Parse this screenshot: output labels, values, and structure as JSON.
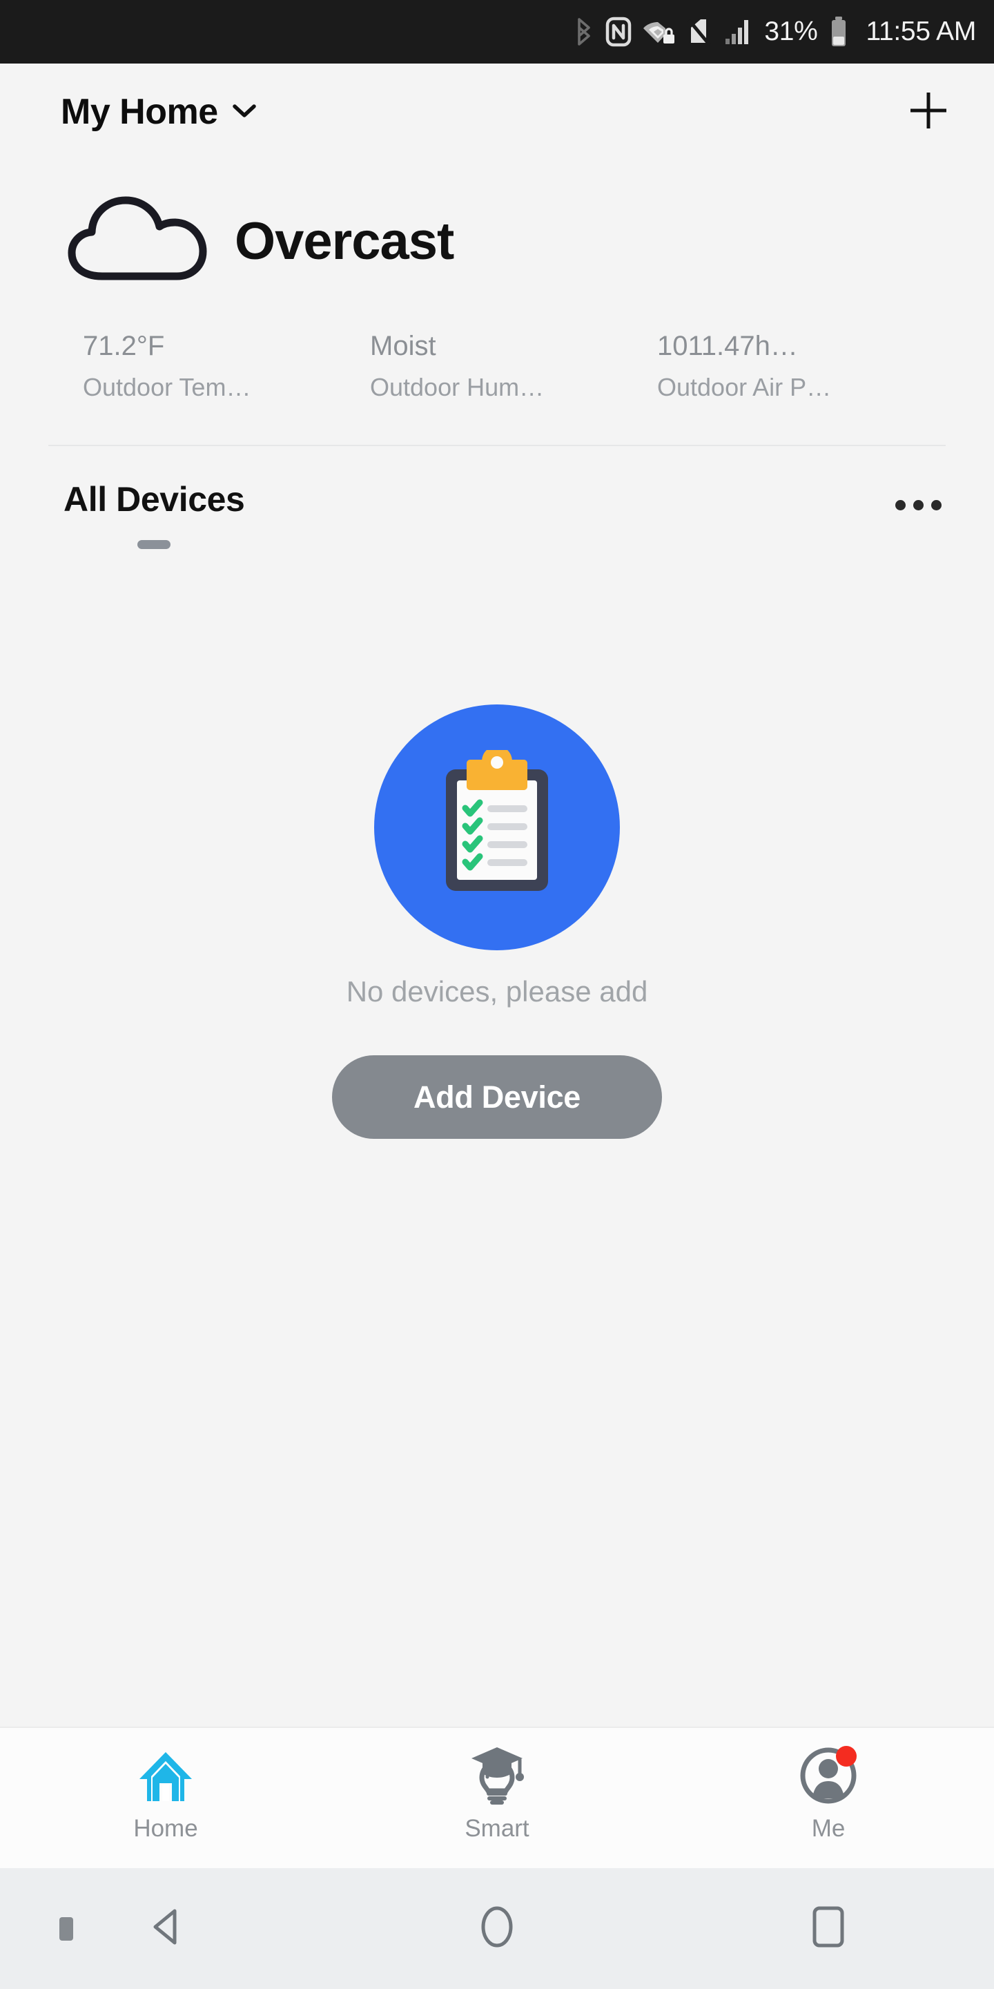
{
  "status_bar": {
    "battery_percent": "31%",
    "time": "11:55 AM",
    "icons": [
      "bluetooth-icon",
      "nfc-icon",
      "wifi-secured-icon",
      "sim-disabled-icon",
      "cellular-signal-icon",
      "battery-icon"
    ]
  },
  "header": {
    "home_name": "My Home",
    "chevron": "chevron-down-icon",
    "add_icon": "plus-icon"
  },
  "weather": {
    "icon": "cloud-icon",
    "description": "Overcast",
    "metrics": [
      {
        "value": "71.2°F",
        "label": "Outdoor Tem…"
      },
      {
        "value": "Moist",
        "label": "Outdoor Hum…"
      },
      {
        "value": "1011.47h…",
        "label": "Outdoor Air P…"
      }
    ]
  },
  "devices_section": {
    "tab_label": "All Devices",
    "more_icon": "more-horizontal-icon",
    "empty_state": {
      "illustration": "clipboard-checklist-icon",
      "message": "No devices, please add",
      "button_label": "Add Device"
    }
  },
  "bottom_nav": {
    "items": [
      {
        "label": "Home",
        "icon": "house-icon",
        "active": true,
        "badge": false
      },
      {
        "label": "Smart",
        "icon": "graduation-bulb-icon",
        "active": false,
        "badge": false
      },
      {
        "label": "Me",
        "icon": "person-circle-icon",
        "active": false,
        "badge": true
      }
    ]
  },
  "system_nav": {
    "buttons": [
      "back-icon",
      "home-icon",
      "recents-icon"
    ]
  },
  "colors": {
    "accent_blue": "#3370f2",
    "nav_active": "#1fb6e8",
    "badge_red": "#f42c20",
    "button_gray": "#84898f",
    "page_bg": "#f4f4f4"
  }
}
